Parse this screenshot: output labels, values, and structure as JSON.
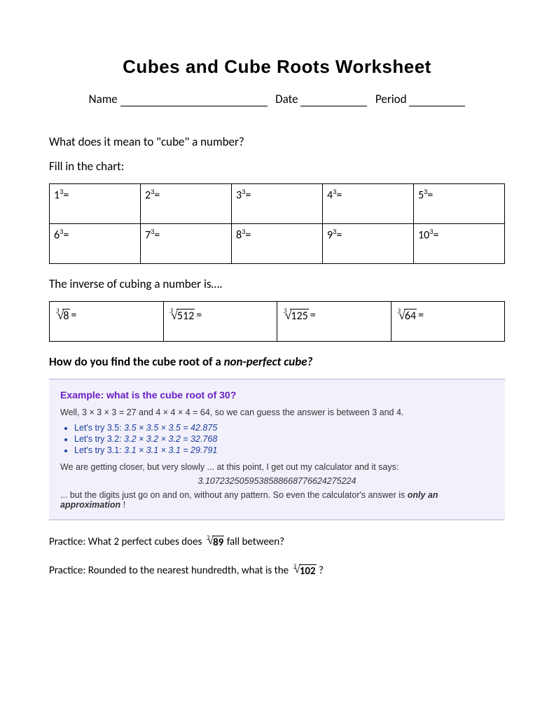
{
  "title": "Cubes and Cube Roots Worksheet",
  "header": {
    "name_label": "Name",
    "date_label": "Date",
    "period_label": "Period"
  },
  "q1": "What does it mean to \"cube\" a number?",
  "fill_label": "Fill in the chart:",
  "cubes_table": {
    "row1": [
      "1",
      "2",
      "3",
      "4",
      "5"
    ],
    "row2": [
      "6",
      "7",
      "8",
      "9",
      "10"
    ]
  },
  "inverse_label": "The inverse of cubing a number is….",
  "roots_table": [
    "8",
    "512",
    "125",
    "64"
  ],
  "nonperfect_heading": "How do you find the cube root of a ",
  "nonperfect_heading_em": "non-perfect cube?",
  "example": {
    "title": "Example: what is the cube root of 30?",
    "intro": "Well, 3 × 3 × 3 = 27 and 4 × 4 × 4 = 64, so we can guess the answer is between 3 and 4.",
    "tries": [
      {
        "lead": "Let's try 3.5: ",
        "calc": "3.5 × 3.5 × 3.5 = 42.875"
      },
      {
        "lead": "Let's try 3.2: ",
        "calc": "3.2 × 3.2 × 3.2 = 32.768"
      },
      {
        "lead": "Let's try 3.1: ",
        "calc": "3.1 × 3.1 × 3.1 = 29.791"
      }
    ],
    "closer": "We are getting closer, but very slowly ... at this point, I get out my calculator and it says:",
    "value": "3.1072325059538588668776624275224",
    "outro_a": "... but the digits just go on and on, without any pattern. So even the calculator's answer is ",
    "outro_b": "only an approximation",
    "outro_c": " !"
  },
  "practice1_a": "Practice: What 2 perfect cubes does ",
  "practice1_rad": "89",
  "practice1_b": " fall between?",
  "practice2_a": "Practice: Rounded to the nearest hundredth, what is the ",
  "practice2_rad": "102",
  "practice2_b": "?"
}
